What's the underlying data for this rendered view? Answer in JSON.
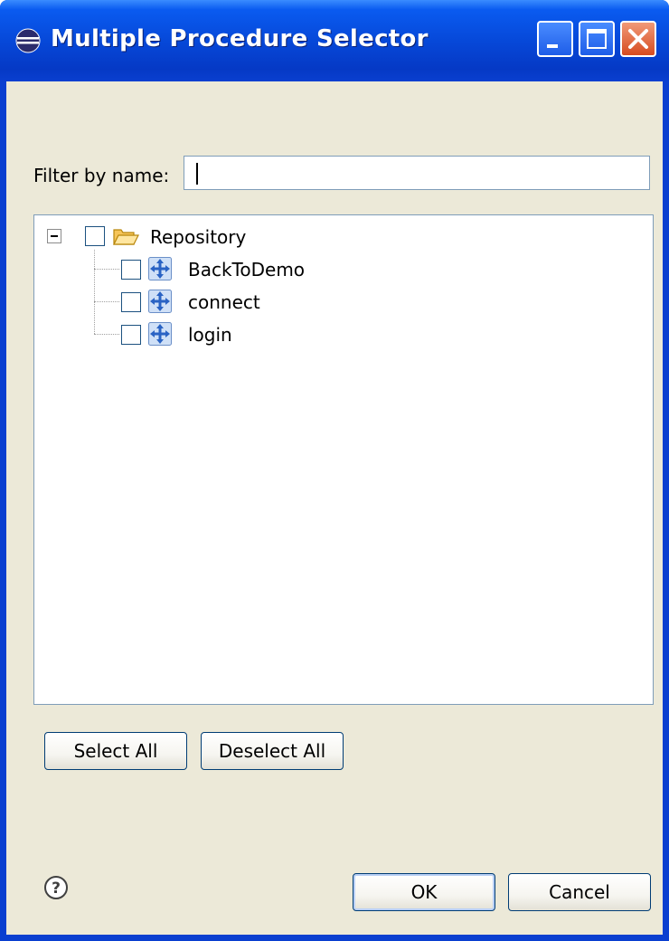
{
  "window": {
    "title": "Multiple Procedure Selector"
  },
  "filter": {
    "label": "Filter by name:",
    "value": ""
  },
  "tree": {
    "root": {
      "label": "Repository",
      "expanded": true,
      "checked": false,
      "icon": "folder-icon"
    },
    "children": [
      {
        "label": "BackToDemo",
        "checked": false,
        "icon": "procedure-icon"
      },
      {
        "label": "connect",
        "checked": false,
        "icon": "procedure-icon"
      },
      {
        "label": "login",
        "checked": false,
        "icon": "procedure-icon"
      }
    ]
  },
  "buttons": {
    "select_all": "Select All",
    "deselect_all": "Deselect All",
    "ok": "OK",
    "cancel": "Cancel"
  },
  "colors": {
    "titlebar": "#0646d6",
    "dialog_background": "#ece9d8",
    "close_button": "#d64b20"
  }
}
